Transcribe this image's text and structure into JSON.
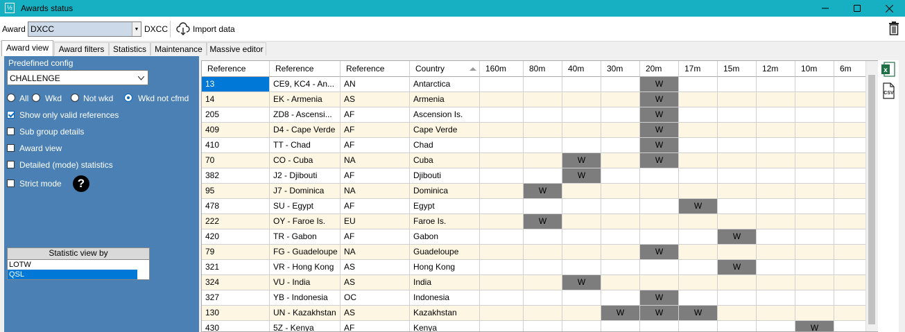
{
  "window": {
    "title": "Awards status",
    "icon": "app-icon"
  },
  "toolbar": {
    "award_label": "Award",
    "award_value": "DXCC",
    "award_name": "DXCC",
    "import_label": "Import data"
  },
  "tabs": [
    "Award view",
    "Award filters",
    "Statistics",
    "Maintenance",
    "Massive editor"
  ],
  "left": {
    "predefined_label": "Predefined config",
    "predefined_value": "CHALLENGE",
    "radios": [
      "All",
      "Wkd",
      "Not wkd",
      "Wkd not cfmd"
    ],
    "selected_radio": "Wkd not cfmd",
    "checks": [
      {
        "label": "Show only valid references",
        "checked": true
      },
      {
        "label": "Sub group details",
        "checked": false
      },
      {
        "label": "Award view",
        "checked": false
      },
      {
        "label": "Detailed (mode) statistics",
        "checked": false
      },
      {
        "label": "Strict mode",
        "checked": false
      }
    ],
    "stat_header": "Statistic view by",
    "stat_items": [
      "LOTW",
      "QSL"
    ],
    "stat_selected": "QSL"
  },
  "grid": {
    "columns": [
      "Reference",
      "Reference",
      "Reference",
      "Country",
      "160m",
      "80m",
      "40m",
      "30m",
      "20m",
      "17m",
      "15m",
      "12m",
      "10m",
      "6m"
    ],
    "rows": [
      [
        "13",
        "CE9, KC4 - An...",
        "AN",
        "Antarctica",
        "",
        "",
        "",
        "",
        "W",
        "",
        "",
        "",
        "",
        ""
      ],
      [
        "14",
        "EK - Armenia",
        "AS",
        "Armenia",
        "",
        "",
        "",
        "",
        "W",
        "",
        "",
        "",
        "",
        ""
      ],
      [
        "205",
        "ZD8 - Ascensi...",
        "AF",
        "Ascension Is.",
        "",
        "",
        "",
        "",
        "W",
        "",
        "",
        "",
        "",
        ""
      ],
      [
        "409",
        "D4 - Cape Verde",
        "AF",
        "Cape Verde",
        "",
        "",
        "",
        "",
        "W",
        "",
        "",
        "",
        "",
        ""
      ],
      [
        "410",
        "TT - Chad",
        "AF",
        "Chad",
        "",
        "",
        "",
        "",
        "W",
        "",
        "",
        "",
        "",
        ""
      ],
      [
        "70",
        "CO - Cuba",
        "NA",
        "Cuba",
        "",
        "",
        "W",
        "",
        "W",
        "",
        "",
        "",
        "",
        ""
      ],
      [
        "382",
        "J2 - Djibouti",
        "AF",
        "Djibouti",
        "",
        "",
        "W",
        "",
        "",
        "",
        "",
        "",
        "",
        ""
      ],
      [
        "95",
        "J7 - Dominica",
        "NA",
        "Dominica",
        "",
        "W",
        "",
        "",
        "",
        "",
        "",
        "",
        "",
        ""
      ],
      [
        "478",
        "SU - Egypt",
        "AF",
        "Egypt",
        "",
        "",
        "",
        "",
        "",
        "W",
        "",
        "",
        "",
        ""
      ],
      [
        "222",
        "OY - Faroe Is.",
        "EU",
        "Faroe Is.",
        "",
        "W",
        "",
        "",
        "",
        "",
        "",
        "",
        "",
        ""
      ],
      [
        "420",
        "TR - Gabon",
        "AF",
        "Gabon",
        "",
        "",
        "",
        "",
        "",
        "",
        "W",
        "",
        "",
        ""
      ],
      [
        "79",
        "FG - Guadeloupe",
        "NA",
        "Guadeloupe",
        "",
        "",
        "",
        "",
        "W",
        "",
        "",
        "",
        "",
        ""
      ],
      [
        "321",
        "VR - Hong Kong",
        "AS",
        "Hong Kong",
        "",
        "",
        "",
        "",
        "",
        "",
        "W",
        "",
        "",
        ""
      ],
      [
        "324",
        "VU - India",
        "AS",
        "India",
        "",
        "",
        "W",
        "",
        "",
        "",
        "",
        "",
        "",
        ""
      ],
      [
        "327",
        "YB - Indonesia",
        "OC",
        "Indonesia",
        "",
        "",
        "",
        "",
        "W",
        "",
        "",
        "",
        "",
        ""
      ],
      [
        "130",
        "UN - Kazakhstan",
        "AS",
        "Kazakhstan",
        "",
        "",
        "",
        "W",
        "W",
        "W",
        "",
        "",
        "",
        ""
      ],
      [
        "430",
        "5Z - Kenya",
        "AF",
        "Kenya",
        "",
        "",
        "",
        "",
        "",
        "",
        "",
        "",
        "W",
        ""
      ]
    ]
  },
  "colors": {
    "titlebar": "#17b0c2",
    "panel": "#4a80b4",
    "row_alt": "#fdf6e3",
    "worked": "#7d7d7d",
    "selection": "#0078d7"
  }
}
